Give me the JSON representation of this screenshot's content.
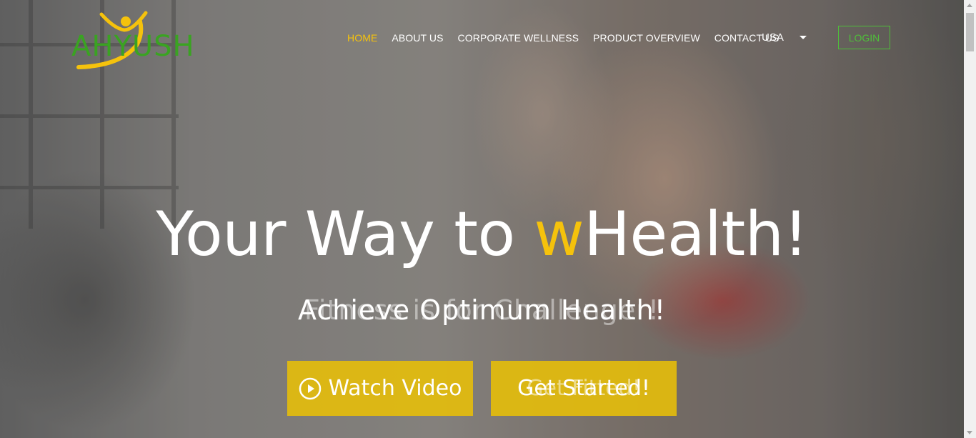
{
  "logo": {
    "text": "AHYUSH",
    "color": "#3aa322",
    "accent": "#f5c20c"
  },
  "nav": {
    "items": [
      {
        "label": "HOME",
        "active": true
      },
      {
        "label": "ABOUT US",
        "active": false
      },
      {
        "label": "CORPORATE WELLNESS",
        "active": false
      },
      {
        "label": "PRODUCT OVERVIEW",
        "active": false
      },
      {
        "label": "CONTACT US",
        "active": false
      }
    ],
    "country": "USA",
    "login": "LOGIN"
  },
  "hero": {
    "headline_before": "Your Way to ",
    "headline_accent": "w",
    "headline_after": "Health!",
    "subtitle_ghost": "Fitness is for Challenger!",
    "subtitle": "Achieve Optimum Health!",
    "watch_video": "Watch Video",
    "get_started": "Get Started!",
    "get_started_ghost": "Get Fitted!"
  },
  "colors": {
    "accent": "#f5c20c",
    "brand_green": "#4fbf3a",
    "button": "#e6be0a"
  },
  "icons": {
    "play": "play-circle-icon",
    "caret": "chevron-down-icon"
  }
}
